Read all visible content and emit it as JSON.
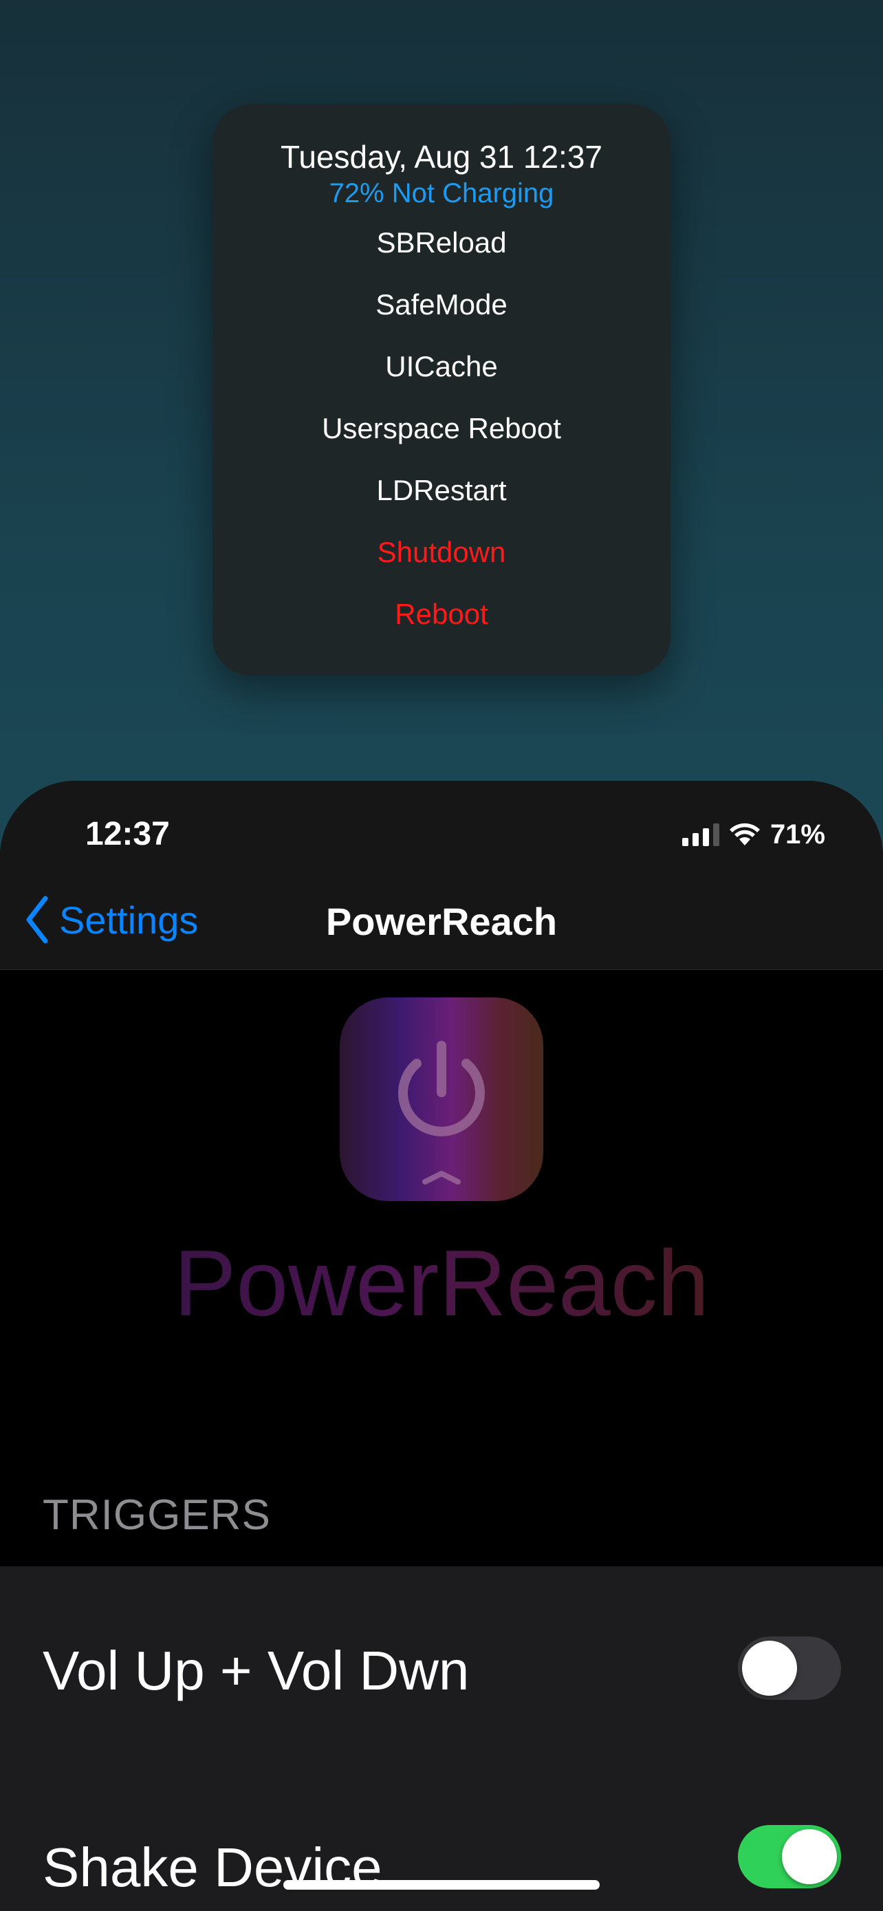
{
  "popup": {
    "date": "Tuesday, Aug 31 12:37",
    "battery_status": "72% Not Charging",
    "items": [
      {
        "label": "SBReload",
        "name": "sbreload-button",
        "danger": false
      },
      {
        "label": "SafeMode",
        "name": "safemode-button",
        "danger": false
      },
      {
        "label": "UICache",
        "name": "uicache-button",
        "danger": false
      },
      {
        "label": "Userspace Reboot",
        "name": "userspace-reboot-button",
        "danger": false
      },
      {
        "label": "LDRestart",
        "name": "ldrestart-button",
        "danger": false
      },
      {
        "label": "Shutdown",
        "name": "shutdown-button",
        "danger": true
      },
      {
        "label": "Reboot",
        "name": "reboot-button",
        "danger": true
      }
    ]
  },
  "status_bar": {
    "time": "12:37",
    "battery": "71%",
    "icons": [
      "signal-icon",
      "wifi-icon"
    ]
  },
  "nav": {
    "back_label": "Settings",
    "title": "PowerReach"
  },
  "header": {
    "wordmark": "PowerReach",
    "icon": "power-icon"
  },
  "triggers": {
    "section_title": "TRIGGERS",
    "rows": [
      {
        "label": "Vol Up + Vol Dwn",
        "enabled": false
      },
      {
        "label": "Shake Device",
        "enabled": true
      }
    ]
  },
  "colors": {
    "accent": "#0a84ff",
    "danger": "#ff1a1a",
    "toggle_on": "#30d158",
    "battery_text": "#1d9bf0"
  }
}
